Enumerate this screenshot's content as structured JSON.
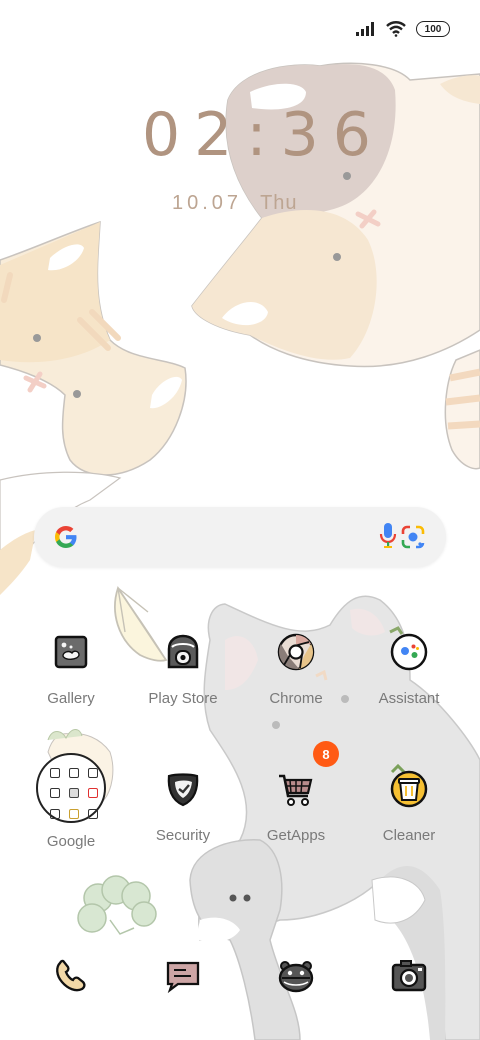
{
  "status_bar": {
    "battery": "100",
    "signal_icon": "signal-icon",
    "wifi_icon": "wifi-icon"
  },
  "clock": {
    "time": "02:36",
    "date": "10.07",
    "weekday": "Thu"
  },
  "search_bar": {
    "logo": "google-g-icon",
    "mic_icon": "mic-icon",
    "lens_icon": "lens-icon"
  },
  "apps": {
    "row1": [
      {
        "label": "Gallery",
        "icon": "gallery-icon"
      },
      {
        "label": "Play Store",
        "icon": "play-store-icon"
      },
      {
        "label": "Chrome",
        "icon": "chrome-icon"
      },
      {
        "label": "Assistant",
        "icon": "assistant-icon"
      }
    ],
    "row2": [
      {
        "label": "Google",
        "icon": "google-folder-icon"
      },
      {
        "label": "Security",
        "icon": "security-icon"
      },
      {
        "label": "GetApps",
        "icon": "getapps-icon",
        "badge": "8"
      },
      {
        "label": "Cleaner",
        "icon": "cleaner-icon"
      }
    ]
  },
  "dock": [
    {
      "icon": "phone-icon"
    },
    {
      "icon": "messages-icon"
    },
    {
      "icon": "browser-icon"
    },
    {
      "icon": "camera-icon"
    }
  ],
  "colors": {
    "clock": "#b09480",
    "badge": "#ff5a14",
    "label": "#7a7a7a",
    "search_bg": "#f2f2f2"
  }
}
